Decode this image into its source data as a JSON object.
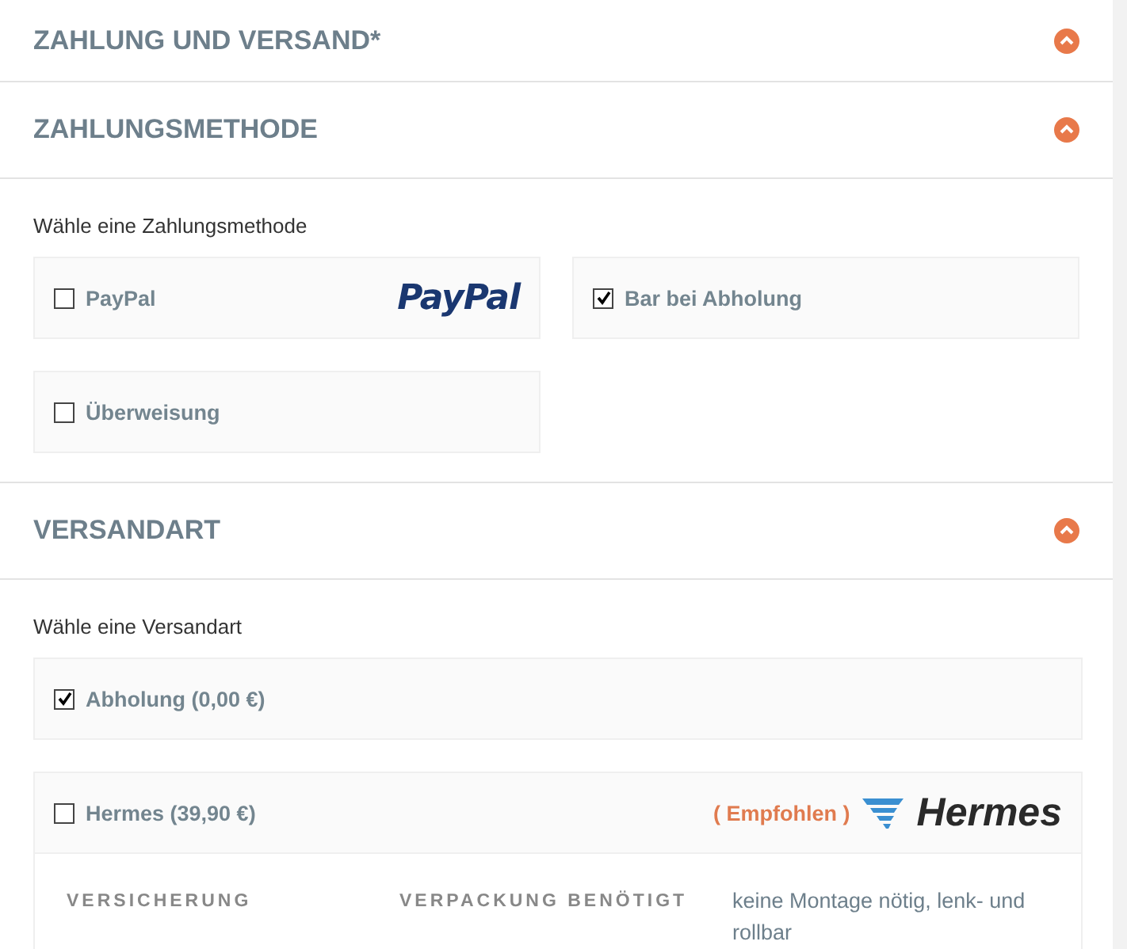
{
  "sections": [
    {
      "title": "ZAHLUNG UND VERSAND*",
      "expanded": true
    },
    {
      "title": "ZAHLUNGSMETHODE",
      "expanded": true,
      "prompt": "Wähle eine Zahlungsmethode",
      "options": [
        {
          "label": "PayPal",
          "checked": false,
          "logo": "PayPal"
        },
        {
          "label": "Bar bei Abholung",
          "checked": true
        },
        {
          "label": "Überweisung",
          "checked": false
        }
      ]
    },
    {
      "title": "VERSANDART",
      "expanded": true,
      "prompt": "Wähle eine Versandart",
      "shipping": [
        {
          "label": "Abholung (0,00 €)",
          "checked": true
        },
        {
          "label": "Hermes (39,90 €)",
          "checked": false,
          "badge": "( Empfohlen )",
          "logo": "Hermes",
          "details": [
            {
              "kind": "heading",
              "text": "VERSICHERUNG"
            },
            {
              "kind": "heading",
              "text": "VERPACKUNG BENÖTIGT"
            },
            {
              "kind": "note",
              "text": "keine Montage nötig, lenk- und rollbar"
            }
          ]
        }
      ]
    }
  ]
}
